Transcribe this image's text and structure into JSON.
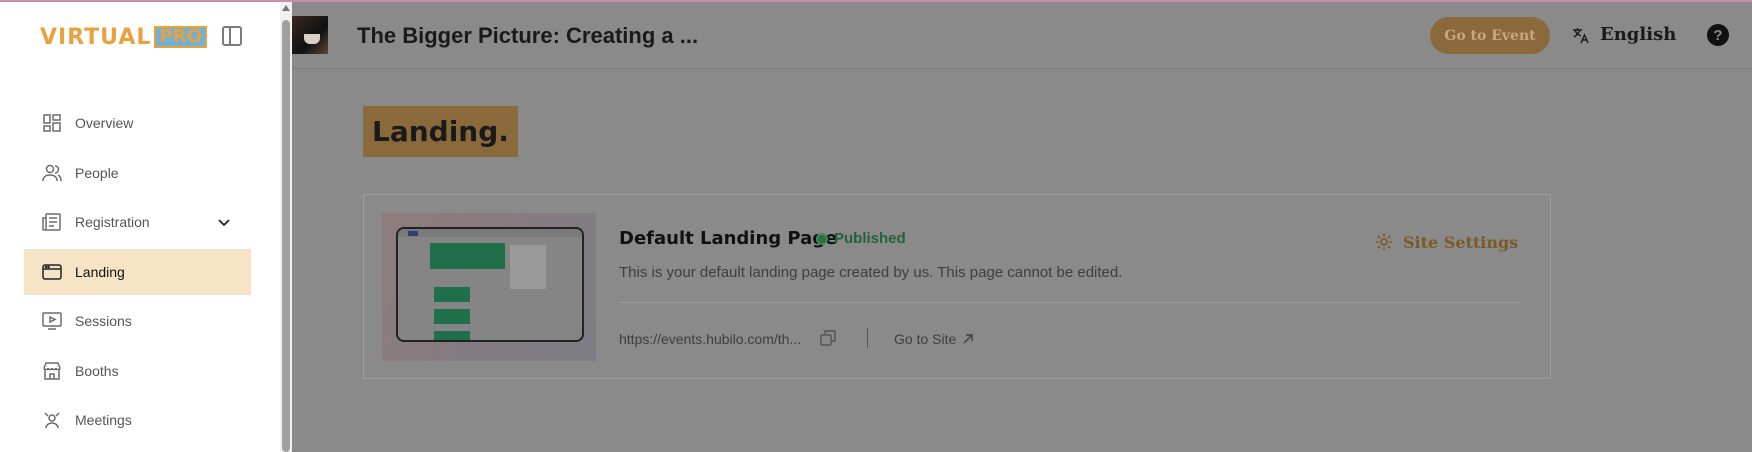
{
  "sidebar": {
    "logo_text": "VIRTUAL",
    "logo_badge": "PRO",
    "items": [
      {
        "label": "Overview",
        "icon": "overview-icon"
      },
      {
        "label": "People",
        "icon": "people-icon"
      },
      {
        "label": "Registration",
        "icon": "registration-icon",
        "expandable": true
      },
      {
        "label": "Landing",
        "icon": "landing-icon",
        "active": true
      },
      {
        "label": "Sessions",
        "icon": "sessions-icon"
      },
      {
        "label": "Booths",
        "icon": "booths-icon"
      },
      {
        "label": "Meetings",
        "icon": "meetings-icon"
      }
    ]
  },
  "header": {
    "event_title": "The Bigger Picture: Creating a ...",
    "go_to_event": "Go to Event",
    "language": "English",
    "help": "?"
  },
  "main": {
    "heading": "Landing."
  },
  "card": {
    "title": "Default Landing Page",
    "status": "Published",
    "description": "This is your default landing page created by us. This page cannot be edited.",
    "url": "https://events.hubilo.com/th...",
    "go_to_site": "Go to Site",
    "site_settings": "Site Settings"
  },
  "colors": {
    "accent": "#e9a23b",
    "active_bg": "#f7e4c6",
    "published": "#2a6f45"
  }
}
